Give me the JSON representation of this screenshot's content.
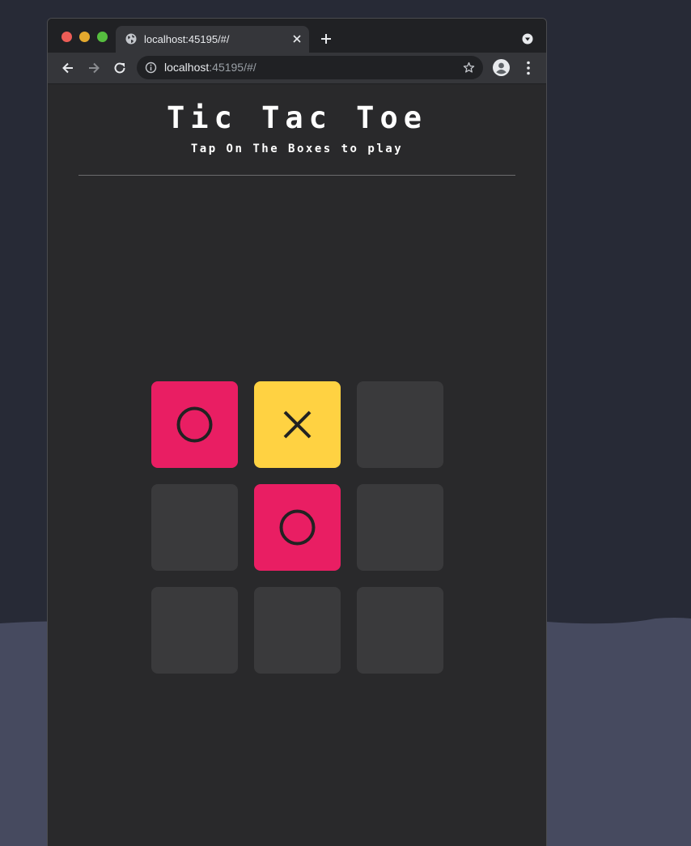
{
  "browser": {
    "tab_title": "localhost:45195/#/",
    "url_host": "localhost",
    "url_rest": ":45195/#/"
  },
  "game": {
    "title": "Tic Tac Toe",
    "subtitle": "Tap On The Boxes to play"
  },
  "board": {
    "cells": [
      "O",
      "X",
      "",
      "",
      "O",
      "",
      "",
      "",
      ""
    ]
  },
  "colors": {
    "o_cell": "#e91e63",
    "x_cell": "#ffd242",
    "empty_cell": "#3a3a3c",
    "mark": "#222222"
  },
  "icons": {
    "back": "arrow-left-icon",
    "forward": "arrow-right-icon",
    "reload": "reload-icon",
    "info": "info-icon",
    "star": "star-icon",
    "profile": "profile-icon",
    "menu": "kebab-menu-icon",
    "new_tab": "plus-icon",
    "close_tab": "close-icon"
  }
}
